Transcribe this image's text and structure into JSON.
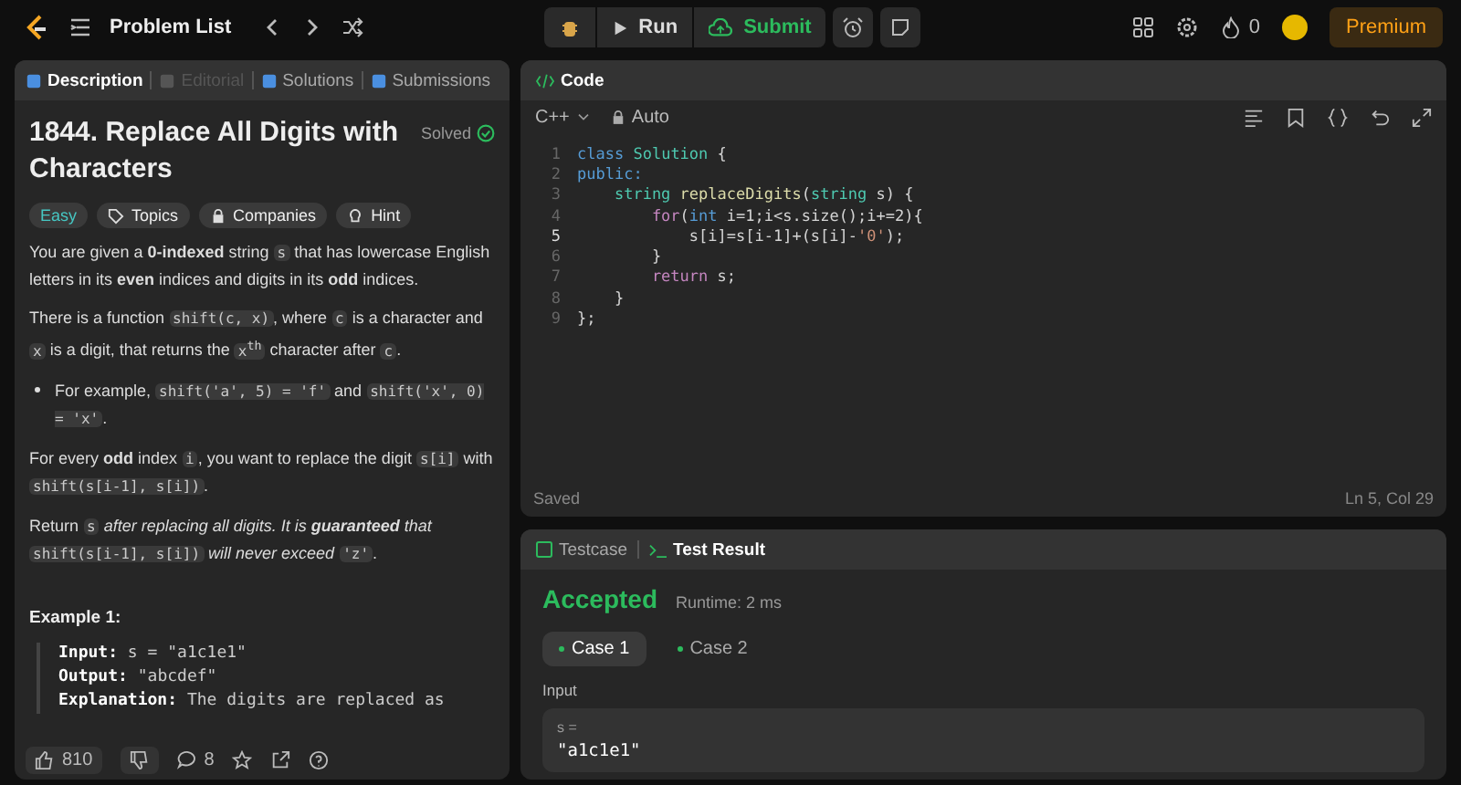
{
  "topbar": {
    "title": "Problem List",
    "run": "Run",
    "submit": "Submit",
    "streak": "0",
    "premium": "Premium"
  },
  "left_tabs": [
    {
      "label": "Description",
      "selected": true,
      "disabled": false
    },
    {
      "label": "Editorial",
      "selected": false,
      "disabled": true
    },
    {
      "label": "Solutions",
      "selected": false,
      "disabled": false
    },
    {
      "label": "Submissions",
      "selected": false,
      "disabled": false
    }
  ],
  "problem": {
    "title": "1844. Replace All Digits with Characters",
    "status": "Solved",
    "difficulty": "Easy",
    "chips": [
      "Topics",
      "Companies",
      "Hint"
    ],
    "paragraphs": [
      {
        "kind": "para",
        "segments": [
          {
            "kind": "text",
            "text": "You are given a **0-indexed** string "
          },
          {
            "kind": "code",
            "text": "s"
          },
          {
            "kind": "text",
            "text": " that has lowercase English letters in its **even** indices and digits in its **odd** indices."
          }
        ]
      },
      {
        "kind": "para",
        "segments": [
          {
            "kind": "text",
            "text": "There is a function "
          },
          {
            "kind": "code",
            "text": "shift(c, x)"
          },
          {
            "kind": "text",
            "text": ", where "
          },
          {
            "kind": "code",
            "text": "c"
          },
          {
            "kind": "text",
            "text": " is a character and "
          },
          {
            "kind": "code",
            "text": "x"
          },
          {
            "kind": "text",
            "text": " is a digit, that returns the "
          },
          {
            "kind": "code",
            "text": "x$^{th}$"
          },
          {
            "kind": "text",
            "text": " character after "
          },
          {
            "kind": "code",
            "text": "c"
          },
          {
            "kind": "text",
            "text": "."
          }
        ]
      },
      {
        "kind": "bullet",
        "segments": [
          {
            "kind": "text",
            "text": "For example, "
          },
          {
            "kind": "code",
            "text": "shift('a', 5) = 'f'"
          },
          {
            "kind": "text",
            "text": " and "
          },
          {
            "kind": "code",
            "text": "shift('x', 0) = 'x'"
          },
          {
            "kind": "text",
            "text": "."
          }
        ]
      },
      {
        "kind": "para",
        "segments": [
          {
            "kind": "text",
            "text": "For every **odd** index "
          },
          {
            "kind": "code",
            "text": "i"
          },
          {
            "kind": "text",
            "text": ", you want to replace the digit "
          },
          {
            "kind": "code",
            "text": "s[i]"
          },
          {
            "kind": "text",
            "text": " with "
          },
          {
            "kind": "code",
            "text": "shift(s[i-1], s[i])"
          },
          {
            "kind": "text",
            "text": "."
          }
        ]
      },
      {
        "kind": "para",
        "segments": [
          {
            "kind": "text",
            "text": "Return "
          },
          {
            "kind": "code",
            "text": "s"
          },
          {
            "kind": "italic",
            "text": " after replacing all digits. It is **guaranteed** that "
          },
          {
            "kind": "code",
            "text": "shift(s[i-1], s[i])"
          },
          {
            "kind": "italic",
            "text": " will never exceed "
          },
          {
            "kind": "code",
            "text": "'z'"
          },
          {
            "kind": "text",
            "text": "."
          }
        ]
      }
    ],
    "example_title": "Example 1:",
    "example_lines": [
      "**Input:** s = \"a1c1e1\"",
      "**Output:** \"abcdef\"",
      "**Explanation:** The digits are replaced as"
    ]
  },
  "footer": {
    "likes": "810",
    "comments": "8"
  },
  "code_panel": {
    "title": "Code",
    "language": "C++",
    "mode": "Auto",
    "status": "Saved",
    "cursor": "Ln 5, Col 29",
    "lines": [
      {
        "number": "1",
        "current": false,
        "tokens": [
          {
            "kind": "kw",
            "text": "class "
          },
          {
            "kind": "type",
            "text": "Solution"
          },
          {
            "kind": "plain",
            "text": " {"
          }
        ]
      },
      {
        "number": "2",
        "current": false,
        "tokens": [
          {
            "kind": "kw",
            "text": "public:"
          }
        ]
      },
      {
        "number": "3",
        "current": false,
        "tokens": [
          {
            "kind": "type",
            "text": "    string "
          },
          {
            "kind": "fn",
            "text": "replaceDigits"
          },
          {
            "kind": "plain",
            "text": "("
          },
          {
            "kind": "type",
            "text": "string "
          },
          {
            "kind": "plain",
            "text": "s) {"
          }
        ]
      },
      {
        "number": "4",
        "current": false,
        "tokens": [
          {
            "kind": "ctrl",
            "text": "        for"
          },
          {
            "kind": "plain",
            "text": "("
          },
          {
            "kind": "kw",
            "text": "int "
          },
          {
            "kind": "plain",
            "text": "i=1;i<s.size();i+=2){"
          }
        ]
      },
      {
        "number": "5",
        "current": true,
        "tokens": [
          {
            "kind": "plain",
            "text": "            s[i]=s[i-1]+(s[i]-"
          },
          {
            "kind": "str",
            "text": "'0'"
          },
          {
            "kind": "plain",
            "text": ");"
          }
        ]
      },
      {
        "number": "6",
        "current": false,
        "tokens": [
          {
            "kind": "plain",
            "text": "        }"
          }
        ]
      },
      {
        "number": "7",
        "current": false,
        "tokens": [
          {
            "kind": "ctrl",
            "text": "        return "
          },
          {
            "kind": "plain",
            "text": "s;"
          }
        ]
      },
      {
        "number": "8",
        "current": false,
        "tokens": [
          {
            "kind": "plain",
            "text": "    }"
          }
        ]
      },
      {
        "number": "9",
        "current": false,
        "tokens": [
          {
            "kind": "plain",
            "text": "};"
          }
        ]
      }
    ]
  },
  "result_tabs": [
    {
      "label": "Testcase",
      "selected": false
    },
    {
      "label": "Test Result",
      "selected": true
    }
  ],
  "result": {
    "verdict": "Accepted",
    "runtime": "Runtime: 2 ms",
    "cases": [
      {
        "label": "Case 1",
        "selected": true
      },
      {
        "label": "Case 2",
        "selected": false
      }
    ],
    "input_label": "Input",
    "var_name": "s =",
    "var_value": "\"a1c1e1\""
  }
}
